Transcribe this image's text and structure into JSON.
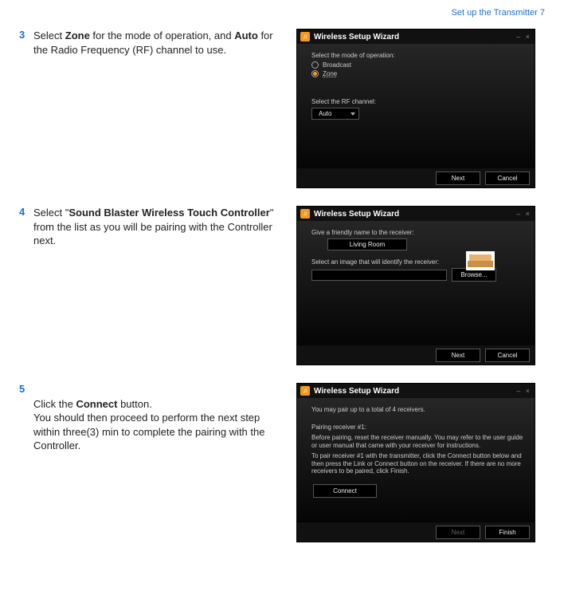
{
  "header": {
    "section": "Set up the Transmitter",
    "page": "7"
  },
  "steps": [
    {
      "num": "3",
      "text_parts": [
        "Select ",
        "Zone",
        " for the mode of operation, and ",
        "Auto",
        " for the Radio Frequency (RF) channel to use."
      ]
    },
    {
      "num": "4",
      "text_parts": [
        "Select \"",
        "Sound Blaster Wireless Touch Controller",
        "\" from the list as you will be pairing with the Controller next."
      ]
    },
    {
      "num": "5",
      "text_parts": [
        "Click the ",
        "Connect",
        " button.\nYou should then proceed to perform the next step within three(3) min to complete the pairing with the Controller."
      ]
    }
  ],
  "wizard_title": "Wireless Setup Wizard",
  "win_controls": "– ×",
  "shot1": {
    "lbl_mode": "Select the mode of operation:",
    "opt1": "Broadcast",
    "opt2": "Zone",
    "lbl_rf": "Select the RF channel:",
    "rf_value": "Auto",
    "next": "Next",
    "cancel": "Cancel"
  },
  "shot2": {
    "lbl_name": "Give a friendly name to the receiver:",
    "name_value": "Living Room",
    "lbl_image": "Select an image that will identify the receiver:",
    "browse": "Browse...",
    "next": "Next",
    "cancel": "Cancel"
  },
  "shot3": {
    "line1": "You may pair up to a total of 4 receivers.",
    "line2": "Pairing receiver #1:",
    "line3": "Before pairing, reset the receiver manually. You may refer to the user guide or user manual that came with your receiver for instructions.",
    "line4": "To pair receiver #1 with the transmitter, click the Connect button below and then press the Link or Connect button on the receiver. If there are no more receivers to be paired, click Finish.",
    "connect": "Connect",
    "next": "Next",
    "finish": "Finish"
  }
}
